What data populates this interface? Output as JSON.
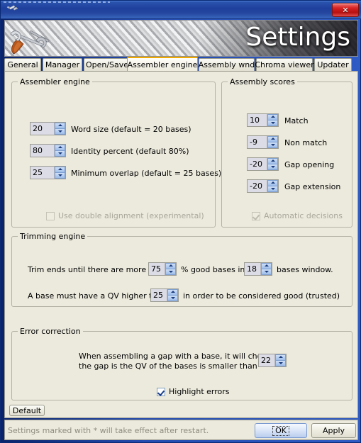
{
  "window": {
    "title_icon": "wrench-icon",
    "close_label": "✕"
  },
  "banner": {
    "title": "Settings"
  },
  "tabs": [
    {
      "label": "General",
      "active": false
    },
    {
      "label": "Manager",
      "active": false
    },
    {
      "label": "Open/Save",
      "active": false
    },
    {
      "label": "Assembler engine",
      "active": true
    },
    {
      "label": "Assembly wnd",
      "active": false
    },
    {
      "label": "Chroma viewer",
      "active": false
    },
    {
      "label": "Updater",
      "active": false
    }
  ],
  "assembler_engine": {
    "title": "Assembler engine",
    "fields": [
      {
        "value": "20",
        "label": "Word size (default = 20 bases)"
      },
      {
        "value": "80",
        "label": "Identity percent (default 80%)"
      },
      {
        "value": "25",
        "label": "Minimum overlap (default = 25 bases)"
      }
    ],
    "checkbox": {
      "label": "Use double alignment (experimental)",
      "checked": false,
      "disabled": true
    }
  },
  "assembly_scores": {
    "title": "Assembly scores",
    "fields": [
      {
        "value": "10",
        "label": "Match"
      },
      {
        "value": "-9",
        "label": "Non match"
      },
      {
        "value": "-20",
        "label": "Gap opening"
      },
      {
        "value": "-20",
        "label": "Gap extension"
      }
    ],
    "checkbox": {
      "label": "Automatic decisions",
      "checked": true,
      "disabled": true
    }
  },
  "trimming_engine": {
    "title": "Trimming engine",
    "row1": {
      "text_before": "Trim ends until there are more than",
      "percent_value": "75",
      "text_middle": "% good bases in a",
      "window_value": "18",
      "text_after": "bases window."
    },
    "row2": {
      "text_before": "A base must have a QV higher than",
      "qv_value": "25",
      "text_after": "in order to be considered good (trusted)"
    }
  },
  "error_correction": {
    "title": "Error correction",
    "description_line1": "When assembling a gap with a base, it will choose",
    "description_line2": "the gap is the QV of the bases is smaller than",
    "qv_value": "22",
    "checkbox": {
      "label": "Highlight errors",
      "checked": true,
      "disabled": false
    }
  },
  "footer": {
    "default_label": "Default",
    "status_text": "Settings marked with * will take effect after restart.",
    "ok_label": "OK",
    "apply_label": "Apply"
  },
  "colors": {
    "accent_tab": "#f2a900",
    "panel_bg": "#eceadd",
    "titlebar": "#1e3f9c",
    "close_red": "#d82222"
  }
}
